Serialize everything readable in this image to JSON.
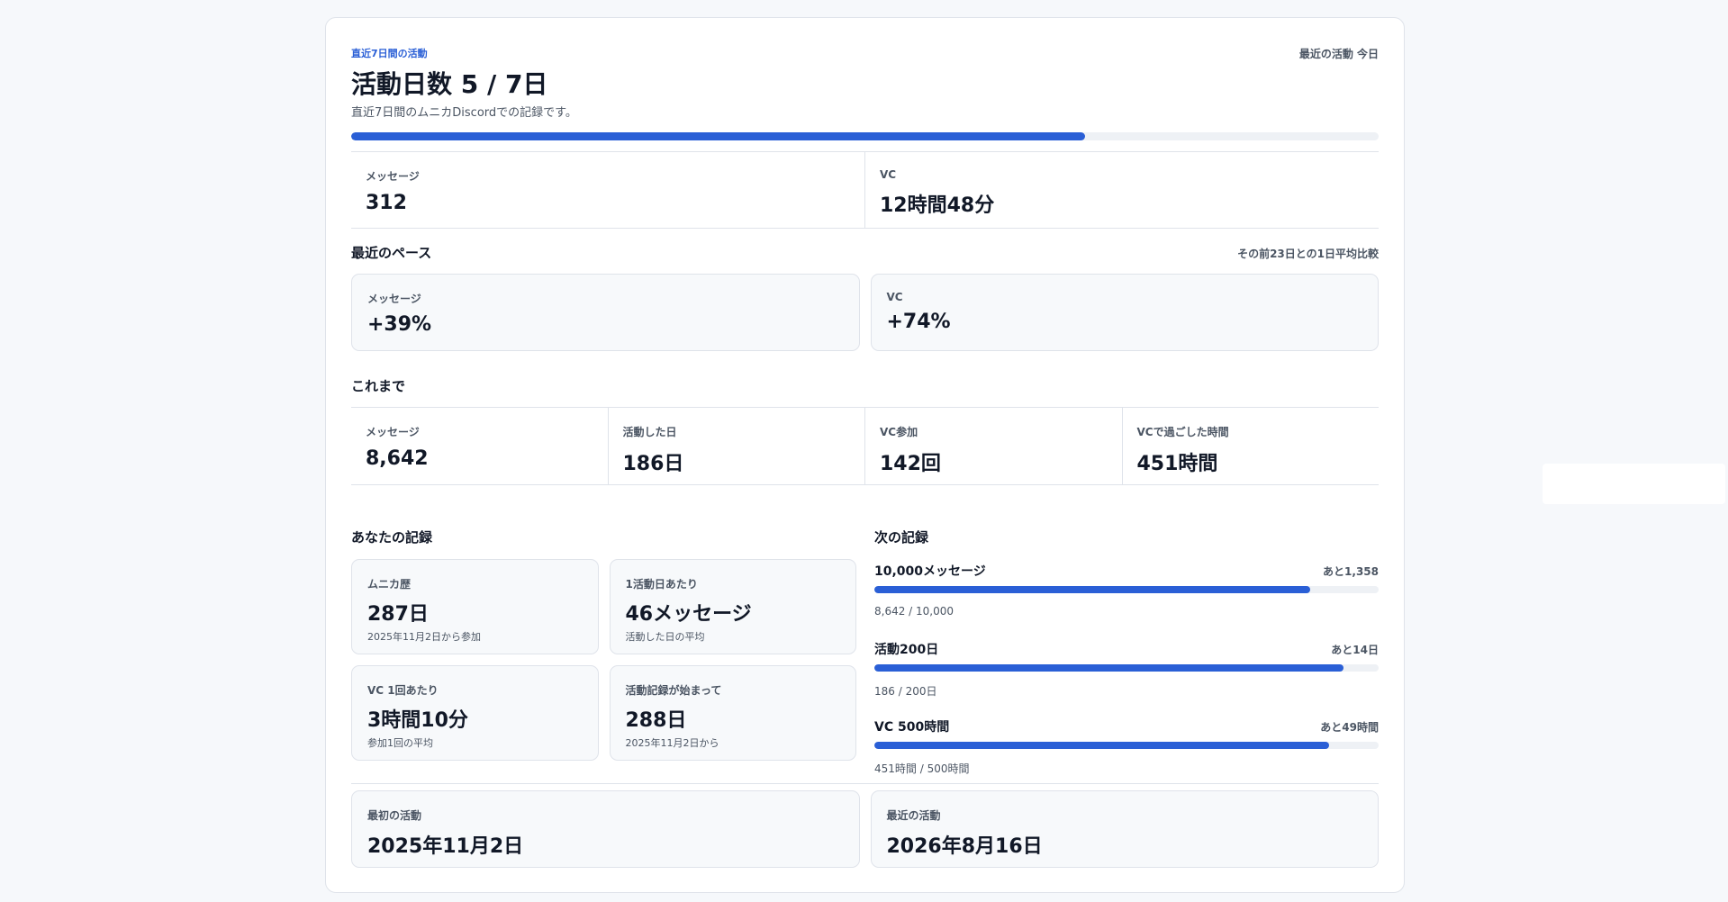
{
  "header": {
    "eyebrow": "直近7日間の活動",
    "recent_label": "最近の活動 今日",
    "title": "活動日数 5 / 7日",
    "subtitle": "直近7日間のムニカDiscordでの記録です。",
    "progress_fraction": 0.714
  },
  "week": [
    {
      "label": "メッセージ",
      "value": "312"
    },
    {
      "label": "VC",
      "value": "12時間48分"
    }
  ],
  "pace": {
    "title": "最近のペース",
    "note": "その前23日との1日平均比較",
    "items": [
      {
        "label": "メッセージ",
        "value": "+39%"
      },
      {
        "label": "VC",
        "value": "+74%"
      }
    ]
  },
  "totals": {
    "title": "これまで",
    "items": [
      {
        "label": "メッセージ",
        "value": "8,642"
      },
      {
        "label": "活動した日",
        "value": "186日"
      },
      {
        "label": "VC参加",
        "value": "142回"
      },
      {
        "label": "VCで過ごした時間",
        "value": "451時間"
      }
    ]
  },
  "records": {
    "title": "あなたの記録",
    "items": [
      {
        "label": "ムニカ歴",
        "value": "287日",
        "sub": "2025年11月2日から参加"
      },
      {
        "label": "1活動日あたり",
        "value": "46メッセージ",
        "sub": "活動した日の平均"
      },
      {
        "label": "VC 1回あたり",
        "value": "3時間10分",
        "sub": "参加1回の平均"
      },
      {
        "label": "活動記録が始まって",
        "value": "288日",
        "sub": "2025年11月2日から"
      }
    ]
  },
  "next": {
    "title": "次の記録",
    "goals": [
      {
        "name": "10,000メッセージ",
        "remain": "あと1,358",
        "progress": "8,642 / 10,000",
        "fraction": 0.864
      },
      {
        "name": "活動200日",
        "remain": "あと14日",
        "progress": "186 / 200日",
        "fraction": 0.93
      },
      {
        "name": "VC 500時間",
        "remain": "あと49時間",
        "progress": "451時間 / 500時間",
        "fraction": 0.902
      }
    ]
  },
  "activity": [
    {
      "label": "最初の活動",
      "value": "2025年11月2日"
    },
    {
      "label": "最近の活動",
      "value": "2026年8月16日"
    }
  ]
}
